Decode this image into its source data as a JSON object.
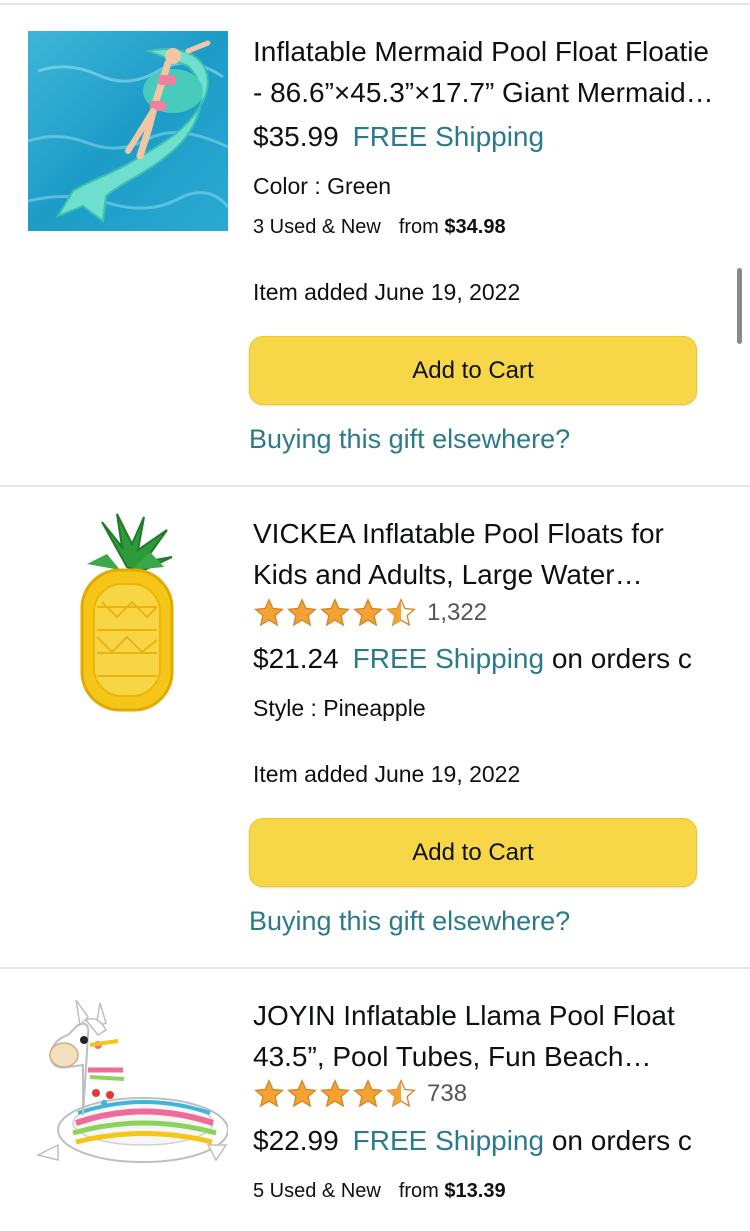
{
  "items": [
    {
      "title": "Inflatable Mermaid Pool Float Floatie - 86.6”×45.3”×17.7” Giant Mermaid Pool Float",
      "price": "$35.99",
      "shipping": "FREE Shipping",
      "variant": "Color : Green",
      "offers_count": "3 Used & New",
      "offers_from_label": "from",
      "offers_from_price": "$34.98",
      "added": "Item added June 19, 2022",
      "cart_label": "Add to Cart",
      "gift_link": "Buying this gift elsewhere?"
    },
    {
      "title": "VICKEA Inflatable Pool Floats for Kids and Adults, Large Water Pineapple Float",
      "rating": 4.5,
      "rating_count": "1,322",
      "price": "$21.24",
      "shipping": "FREE Shipping",
      "shipping_suffix": "on orders c",
      "variant": "Style : Pineapple",
      "added": "Item added June 19, 2022",
      "cart_label": "Add to Cart",
      "gift_link": "Buying this gift elsewhere?"
    },
    {
      "title": "JOYIN Inflatable Llama Pool Float 43.5”, Pool Tubes, Fun Beach Floaties",
      "rating": 4.5,
      "rating_count": "738",
      "price": "$22.99",
      "shipping": "FREE Shipping",
      "shipping_suffix": "on orders c",
      "offers_count": "5 Used & New",
      "offers_from_label": "from",
      "offers_from_price": "$13.39"
    }
  ],
  "icons": {
    "star": "star-icon",
    "half_star": "half-star-icon"
  },
  "colors": {
    "cart_button": "#f7d748",
    "link": "#2b7a8a",
    "star": "#f4a333"
  }
}
